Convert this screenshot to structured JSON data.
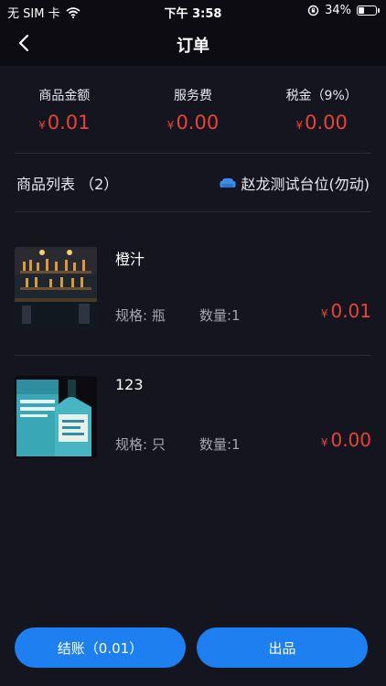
{
  "status_bar": {
    "carrier": "无 SIM 卡",
    "time": "下午 3:58",
    "battery": "34%",
    "battery_level": 0.34
  },
  "nav": {
    "title": "订单"
  },
  "summary": [
    {
      "label": "商品金额",
      "currency": "¥",
      "amount": "0.01"
    },
    {
      "label": "服务费",
      "currency": "¥",
      "amount": "0.00"
    },
    {
      "label": "税金（9%）",
      "currency": "¥",
      "amount": "0.00"
    }
  ],
  "list": {
    "title": "商品列表 （2）",
    "seat": "赵龙测试台位(勿动)"
  },
  "items": [
    {
      "name": "橙汁",
      "spec": "规格: 瓶",
      "qty": "数量:1",
      "currency": "¥",
      "price": "0.01",
      "thumb_icon": "bar-photo"
    },
    {
      "name": "123",
      "spec": "规格: 只",
      "qty": "数量:1",
      "currency": "¥",
      "price": "0.00",
      "thumb_icon": "whisky-bottle-photo"
    }
  ],
  "footer": {
    "checkout_label": "结账（0.01）",
    "serve_label": "出品"
  },
  "colors": {
    "accent": "#1e7ff0",
    "price": "#e8433a",
    "background": "#15151f"
  }
}
